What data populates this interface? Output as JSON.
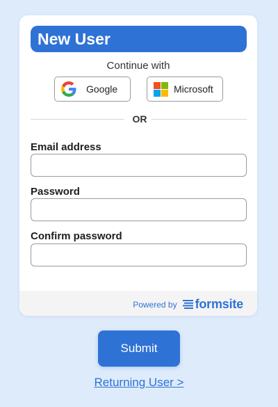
{
  "form": {
    "title": "New User",
    "continue_with": "Continue with",
    "social": {
      "google_label": "Google",
      "microsoft_label": "Microsoft"
    },
    "divider_text": "OR",
    "fields": [
      {
        "label": "Email address",
        "value": "",
        "placeholder": ""
      },
      {
        "label": "Password",
        "value": "",
        "placeholder": ""
      },
      {
        "label": "Confirm password",
        "value": "",
        "placeholder": ""
      }
    ],
    "footer": {
      "powered_by": "Powered by",
      "brand": "formsite",
      "brand_icon": "formsite-logo-icon"
    }
  },
  "actions": {
    "submit_label": "Submit",
    "returning_link": "Returning User >"
  },
  "icons": {
    "google": "google-logo-icon",
    "microsoft": "microsoft-logo-icon"
  },
  "colors": {
    "page_background": "#deebfb",
    "accent": "#2f72d6",
    "card_background": "#ffffff",
    "footer_background": "#f4f4f4"
  }
}
